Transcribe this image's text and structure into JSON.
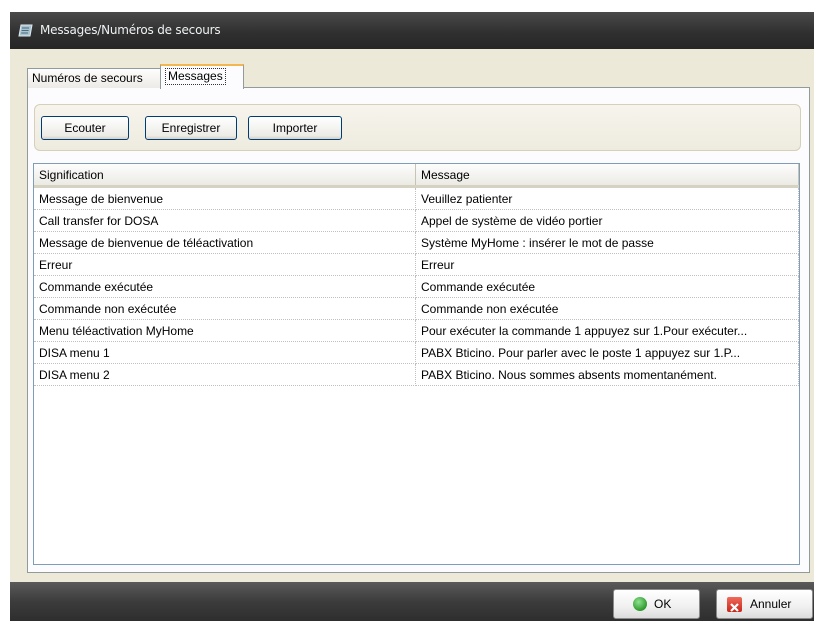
{
  "window": {
    "title": "Messages/Numéros de secours",
    "icon": "notebook-icon"
  },
  "tabs": [
    {
      "label": "Numéros de secours",
      "active": false
    },
    {
      "label": "Messages",
      "active": true
    }
  ],
  "toolbar": {
    "listen_label": "Ecouter",
    "record_label": "Enregistrer",
    "import_label": "Importer"
  },
  "table": {
    "columns": [
      "Signification",
      "Message"
    ],
    "rows": [
      [
        "Message de bienvenue",
        "Veuillez patienter"
      ],
      [
        "Call transfer for DOSA",
        "Appel de système de vidéo portier"
      ],
      [
        "Message de bienvenue de téléactivation",
        "Système MyHome : insérer le mot de passe"
      ],
      [
        "Erreur",
        "Erreur"
      ],
      [
        "Commande exécutée",
        "Commande exécutée"
      ],
      [
        "Commande non exécutée",
        "Commande non exécutée"
      ],
      [
        "Menu téléactivation MyHome",
        "Pour exécuter la commande 1 appuyez sur 1.Pour exécuter..."
      ],
      [
        "DISA menu 1",
        "PABX Bticino. Pour parler avec le poste 1 appuyez sur 1.P..."
      ],
      [
        "DISA menu 2",
        "PABX Bticino. Nous sommes absents momentanément."
      ]
    ]
  },
  "footer": {
    "ok_label": "OK",
    "cancel_label": "Annuler",
    "ok_icon": "check-circle-icon",
    "cancel_icon": "red-x-icon"
  },
  "colors": {
    "titlebar": "#333333",
    "active_tab_accent": "#f2b74e",
    "button_border": "#003c74"
  }
}
